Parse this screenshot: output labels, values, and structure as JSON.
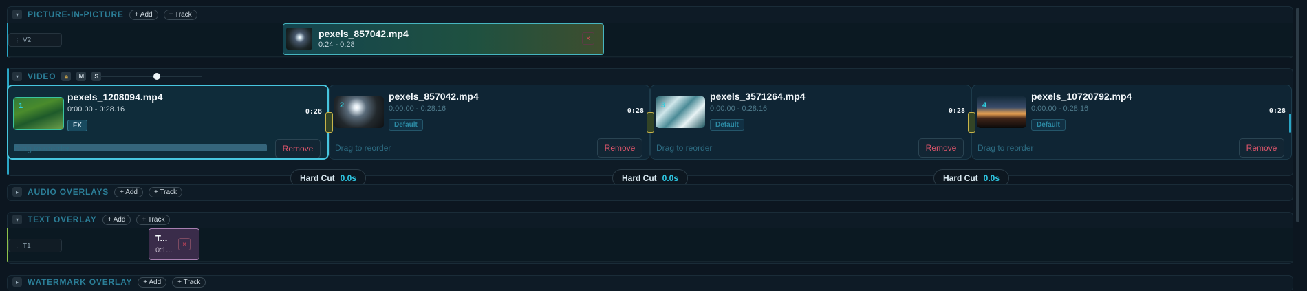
{
  "sections": {
    "pip": {
      "title": "PICTURE-IN-PICTURE",
      "add": "+ Add",
      "track": "+ Track"
    },
    "video": {
      "title": "VIDEO",
      "m": "M",
      "s": "S"
    },
    "audio": {
      "title": "AUDIO OVERLAYS",
      "add": "+ Add",
      "track": "+ Track"
    },
    "text": {
      "title": "TEXT OVERLAY",
      "add": "+ Add",
      "track": "+ Track"
    },
    "watermark": {
      "title": "WATERMARK OVERLAY",
      "add": "+ Add",
      "track": "+ Track"
    }
  },
  "lanes": {
    "v2": "V2",
    "t1": "T1"
  },
  "pip_clip": {
    "name": "pexels_857042.mp4",
    "time": "0:24 - 0:28",
    "close": "×"
  },
  "video_clips": [
    {
      "num": "1",
      "name": "pexels_1208094.mp4",
      "time": "0:00.00 - 0:28.16",
      "duration": "0:28",
      "badge": "FX",
      "drag": "Drag to reorder",
      "remove": "Remove"
    },
    {
      "num": "2",
      "name": "pexels_857042.mp4",
      "time": "0:00.00 - 0:28.16",
      "duration": "0:28",
      "badge": "Default",
      "drag": "Drag to reorder",
      "remove": "Remove"
    },
    {
      "num": "3",
      "name": "pexels_3571264.mp4",
      "time": "0:00.00 - 0:28.16",
      "duration": "0:28",
      "badge": "Default",
      "drag": "Drag to reorder",
      "remove": "Remove"
    },
    {
      "num": "4",
      "name": "pexels_10720792.mp4",
      "time": "0:00.00 - 0:28.16",
      "duration": "0:28",
      "badge": "Default",
      "drag": "Drag to reorder",
      "remove": "Remove"
    }
  ],
  "transitions": [
    {
      "label": "Hard Cut",
      "value": "0.0s"
    },
    {
      "label": "Hard Cut",
      "value": "0.0s"
    },
    {
      "label": "Hard Cut",
      "value": "0.0s"
    }
  ],
  "text_clip": {
    "title": "T...",
    "time": "0:1...",
    "close": "×"
  },
  "icons": {
    "caret": "chevron-icon",
    "lock": "lock-icon",
    "grip": "grip-icon"
  },
  "colors": {
    "accent": "#47c6df",
    "section_title": "#2b7e97",
    "remove": "#e0566c",
    "handle": "#c8b44a"
  }
}
